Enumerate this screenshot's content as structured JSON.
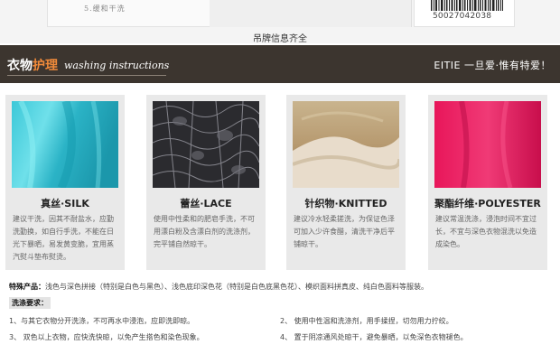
{
  "tag_strip": {
    "tag_item": "5.缓和干洗",
    "barcode_number": "50027042038",
    "caption": "吊牌信息齐全"
  },
  "banner": {
    "title_part1": "衣物",
    "title_part2": "护理",
    "title_en": "washing instructions",
    "slogan": "EITIE 一旦爱·惟有特爱！",
    "accent_color": "#f08a3a",
    "bg_color": "#3c352f"
  },
  "fabrics": [
    {
      "name": "真丝·SILK",
      "desc": "建议干洗，因其不耐盐水，应勤洗勤换，如自行手洗，不能在日光下暴晒，易发黄变脆，宜用蒸汽熨斗垫布熨烫。"
    },
    {
      "name": "蕾丝·LACE",
      "desc": "使用中性柔和的肥皂手洗，不可用漂白粉及含漂白剂的洗涤剂，完平铺自然晾干。"
    },
    {
      "name": "针织物·KNITTED",
      "desc": "建议冷水轻柔搓洗，为保证色泽可加入少许食醋，清洗干净后平铺晾干。"
    },
    {
      "name": "聚酯纤维·POLYESTER",
      "desc": "建议常温洗涤，浸泡时间不宜过长，不宜与深色衣物混洗以免造成染色。"
    }
  ],
  "notes": {
    "special_label": "特殊产品：",
    "special_text": "浅色与深色拼接（特别是白色与黑色）、浅色底印深色花（特别是白色底黑色花）、模织面料拼真皮、纯白色面料等服装。",
    "wash_label": "洗涤要求：",
    "rules": [
      "1、与其它衣物分开洗涤，不可再水中浸泡，应即洗即晾。",
      "2、 使用中性温和洗涤剂，用手揉捏，切勿用力拧绞。",
      "3、 双色以上衣物，应快洗快晾，以免产生搭色和染色现象。",
      "4、 置于阴凉通风处晾干，避免暴晒，以免深色衣物褪色。"
    ]
  }
}
